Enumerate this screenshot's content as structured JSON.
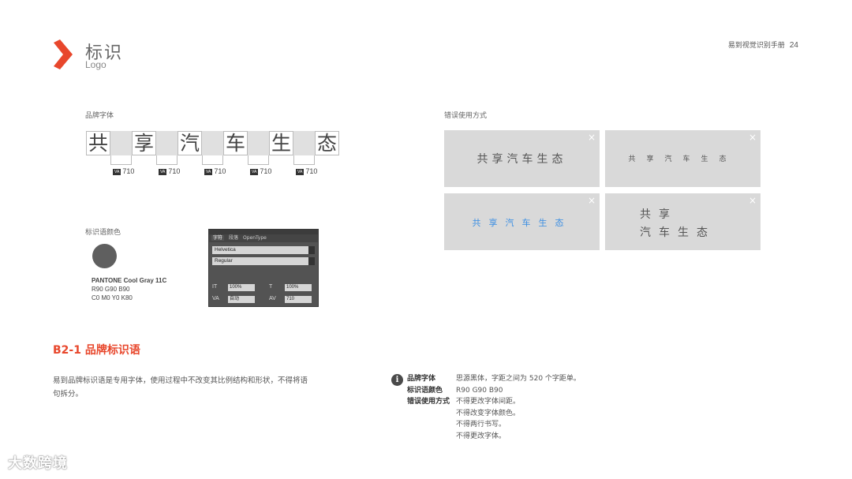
{
  "header": {
    "title_cn": "标识",
    "title_en": "Logo",
    "manual_name": "易到视觉识别手册",
    "page_number": "24",
    "accent_color": "#e8472c"
  },
  "font_section": {
    "label": "品牌字体",
    "glyphs": [
      "共",
      "享",
      "汽",
      "车",
      "生",
      "态"
    ],
    "kerning": [
      "710",
      "710",
      "710",
      "710",
      "710"
    ],
    "kern_icon": "VA"
  },
  "color_section": {
    "label": "标识语颜色",
    "swatch_color": "#5f5f5f",
    "lines": [
      "PANTONE Cool Gray 11C",
      "R90 G90 B90",
      "C0 M0 Y0 K80"
    ]
  },
  "char_panel": {
    "tabs": [
      "字符",
      "段落",
      "OpenType"
    ],
    "font": "Helvetica",
    "style": "Regular",
    "vscale": "100%",
    "hscale": "100%",
    "kerning": "自动",
    "tracking": "710"
  },
  "misuse_section": {
    "label": "错误使用方式",
    "close_icon": "×",
    "cards": [
      {
        "text": "共享汽车生态"
      },
      {
        "text": "共享汽车生态"
      },
      {
        "text": "共享汽车生态",
        "color": "#3b8ee3"
      },
      {
        "line1": "共享",
        "line2": "汽车生态"
      }
    ]
  },
  "section_title": "B2-1 品牌标识语",
  "description": "易到品牌标识语是专用字体，使用过程中不改变其比例结构和形状，不得将语句拆分。",
  "info": {
    "icon": "i",
    "rows": [
      {
        "key": "品牌字体",
        "value": "思源黑体，字距之间为 520 个字距单。"
      },
      {
        "key": "标识语颜色",
        "value": "R90 G90 B90"
      },
      {
        "key": "错误使用方式",
        "value": "不得更改字体间距。"
      },
      {
        "key": "",
        "value": "不得改变字体颜色。"
      },
      {
        "key": "",
        "value": "不得两行书写。"
      },
      {
        "key": "",
        "value": "不得更改字体。"
      }
    ]
  },
  "watermark": "大数跨境"
}
